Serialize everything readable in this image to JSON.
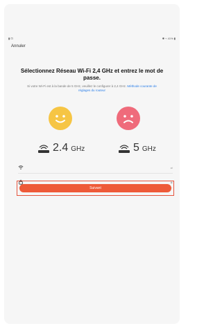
{
  "statusbar": {
    "left": "▮ ⊡",
    "right": "✱ ⌁ 41% ▮"
  },
  "nav": {
    "cancel_label": "Annuler"
  },
  "main": {
    "title": "Sélectionnez Réseau Wi-Fi 2,4 GHz et entrez le mot de passe.",
    "subtitle_text": "Si votre Wi-Fi est à  la bande de 5 GHz, veuillez le configurer à 2,4 GHz.",
    "subtitle_link": "Méthode courante de réglages du routeur",
    "band_24_num": "2.4",
    "band_24_unit": "GHz",
    "band_5_num": "5",
    "band_5_unit": "GHz"
  },
  "form": {
    "wifi_right": "⇄",
    "password_right": "◉",
    "submit_label": "Suivant"
  },
  "colors": {
    "accent": "#EE5A38",
    "happy": "#F6C544",
    "sad": "#EF6B7B",
    "link": "#2A7EE8"
  }
}
